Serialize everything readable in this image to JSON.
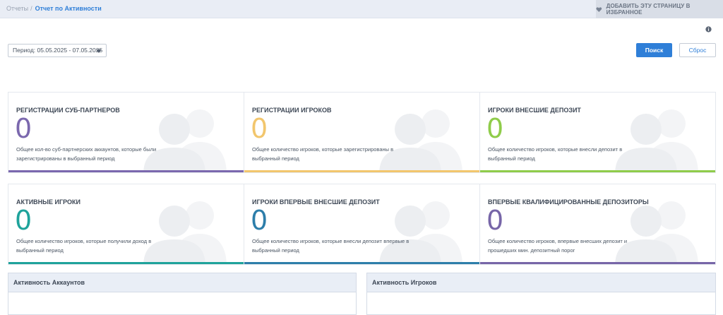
{
  "breadcrumb": {
    "root": "Отчеты",
    "separator": "/",
    "current": "Отчет по Активности"
  },
  "favorites_button": {
    "label": "ДОБАВИТЬ ЭТУ СТРАНИЦУ В ИЗБРАННОЕ",
    "icon": "heart-icon"
  },
  "filter": {
    "period_value": "Период: 05.05.2025 - 07.05.2025",
    "search_label": "Поиск",
    "reset_label": "Сброс"
  },
  "cards": [
    {
      "title": "РЕГИСТРАЦИИ СУБ-ПАРТНЕРОВ",
      "value": "0",
      "color": "#7b68ae",
      "description": "Общее кол-во суб-партнерских аккаунтов, которые были зарегистрированы в выбранный период"
    },
    {
      "title": "РЕГИСТРАЦИИ ИГРОКОВ",
      "value": "0",
      "color": "#f2c66d",
      "description": "Общее количество игроков, которые зарегистрированы в выбранный период"
    },
    {
      "title": "ИГРОКИ ВНЕСШИЕ ДЕПОЗИТ",
      "value": "0",
      "color": "#8fcc4a",
      "description": "Общее количество игроков, которые внесли депозит в выбранный период"
    },
    {
      "title": "АКТИВНЫЕ ИГРОКИ",
      "value": "0",
      "color": "#1fa39b",
      "description": "Общее количество игроков, которые получили доход в выбранный период"
    },
    {
      "title": "ИГРОКИ ВПЕРВЫЕ ВНЕСШИЕ ДЕПОЗИТ",
      "value": "0",
      "color": "#2d7eaa",
      "description": "Общее количество игроков, которые внесли депозит впервые в выбранный период"
    },
    {
      "title": "ВПЕРВЫЕ КВАЛИФИЦИРОВАННЫЕ ДЕПОЗИТОРЫ",
      "value": "0",
      "color": "#7766a8",
      "description": "Общее количество игроков, впервые внесших депозит и прошедших мин. депозитный порог"
    }
  ],
  "panels": {
    "accounts_title": "Активность Аккаунтов",
    "players_title": "Активность Игроков"
  }
}
